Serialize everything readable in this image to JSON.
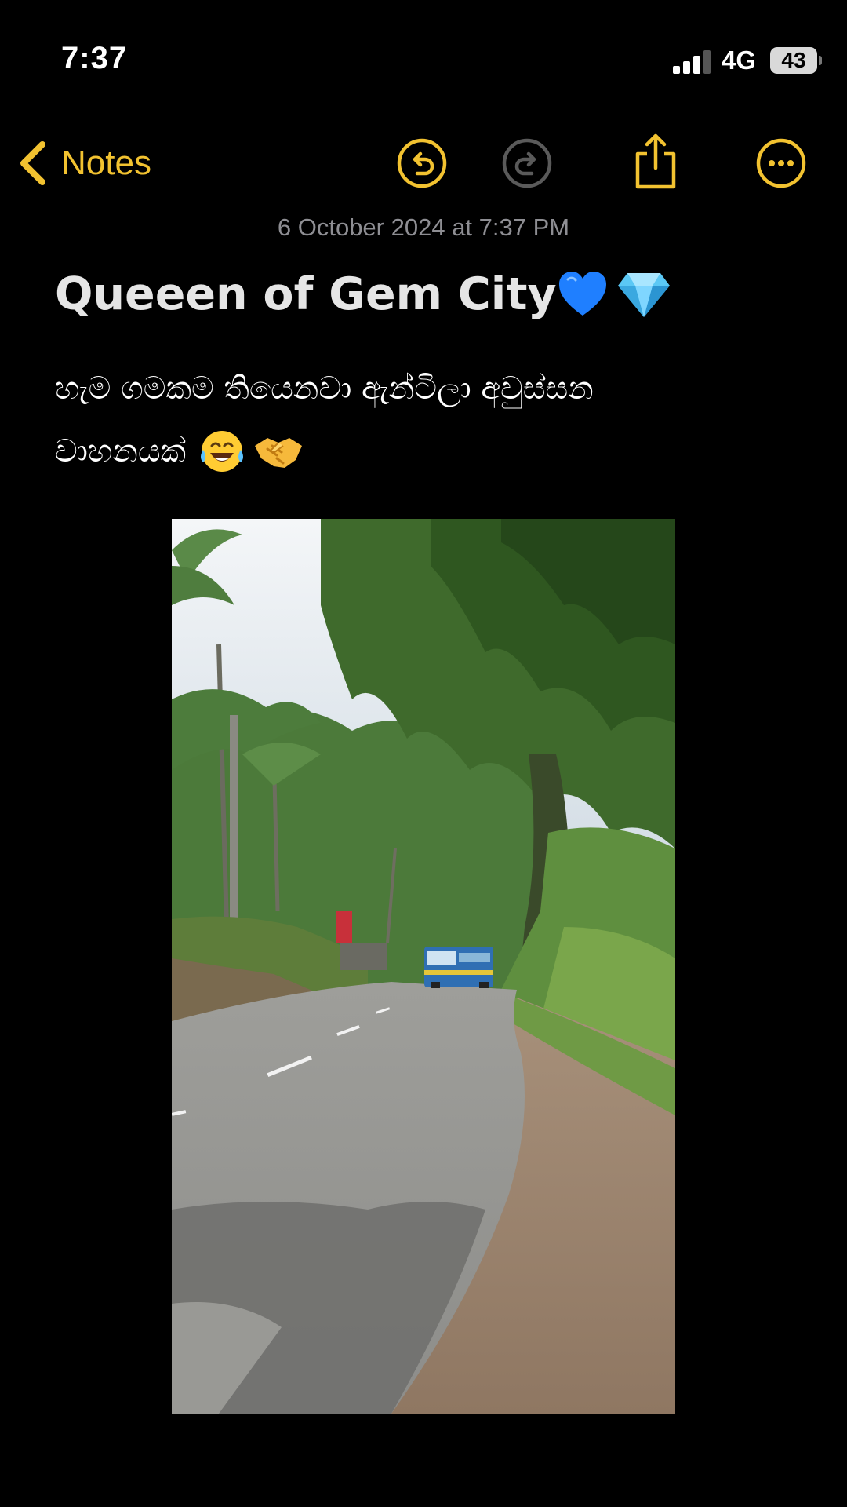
{
  "status_bar": {
    "time": "7:37",
    "network": "4G",
    "battery_percent": "43",
    "signal_bars_active": 3,
    "signal_bars_total": 4
  },
  "nav": {
    "back_label": "Notes",
    "icons": [
      "chevron-left-icon",
      "undo-icon",
      "redo-icon",
      "share-icon",
      "more-icon"
    ],
    "accent_color": "#f2c230",
    "disabled_color": "#5a5a5a"
  },
  "note": {
    "timestamp": "6 October 2024 at 7:37 PM",
    "title": "Queeen of Gem City",
    "title_emojis": [
      "blue-heart-icon",
      "gem-icon"
    ],
    "body_line_1": "හැම ගමකම තියෙනවා ඇන්ටිලා අවුස්සන",
    "body_line_2": "වාහනයක්",
    "body_emojis": [
      "tears-of-joy-icon",
      "handshake-icon"
    ]
  },
  "attachment": {
    "type": "photo",
    "subject": "rural road with palm trees and a blue bus"
  }
}
